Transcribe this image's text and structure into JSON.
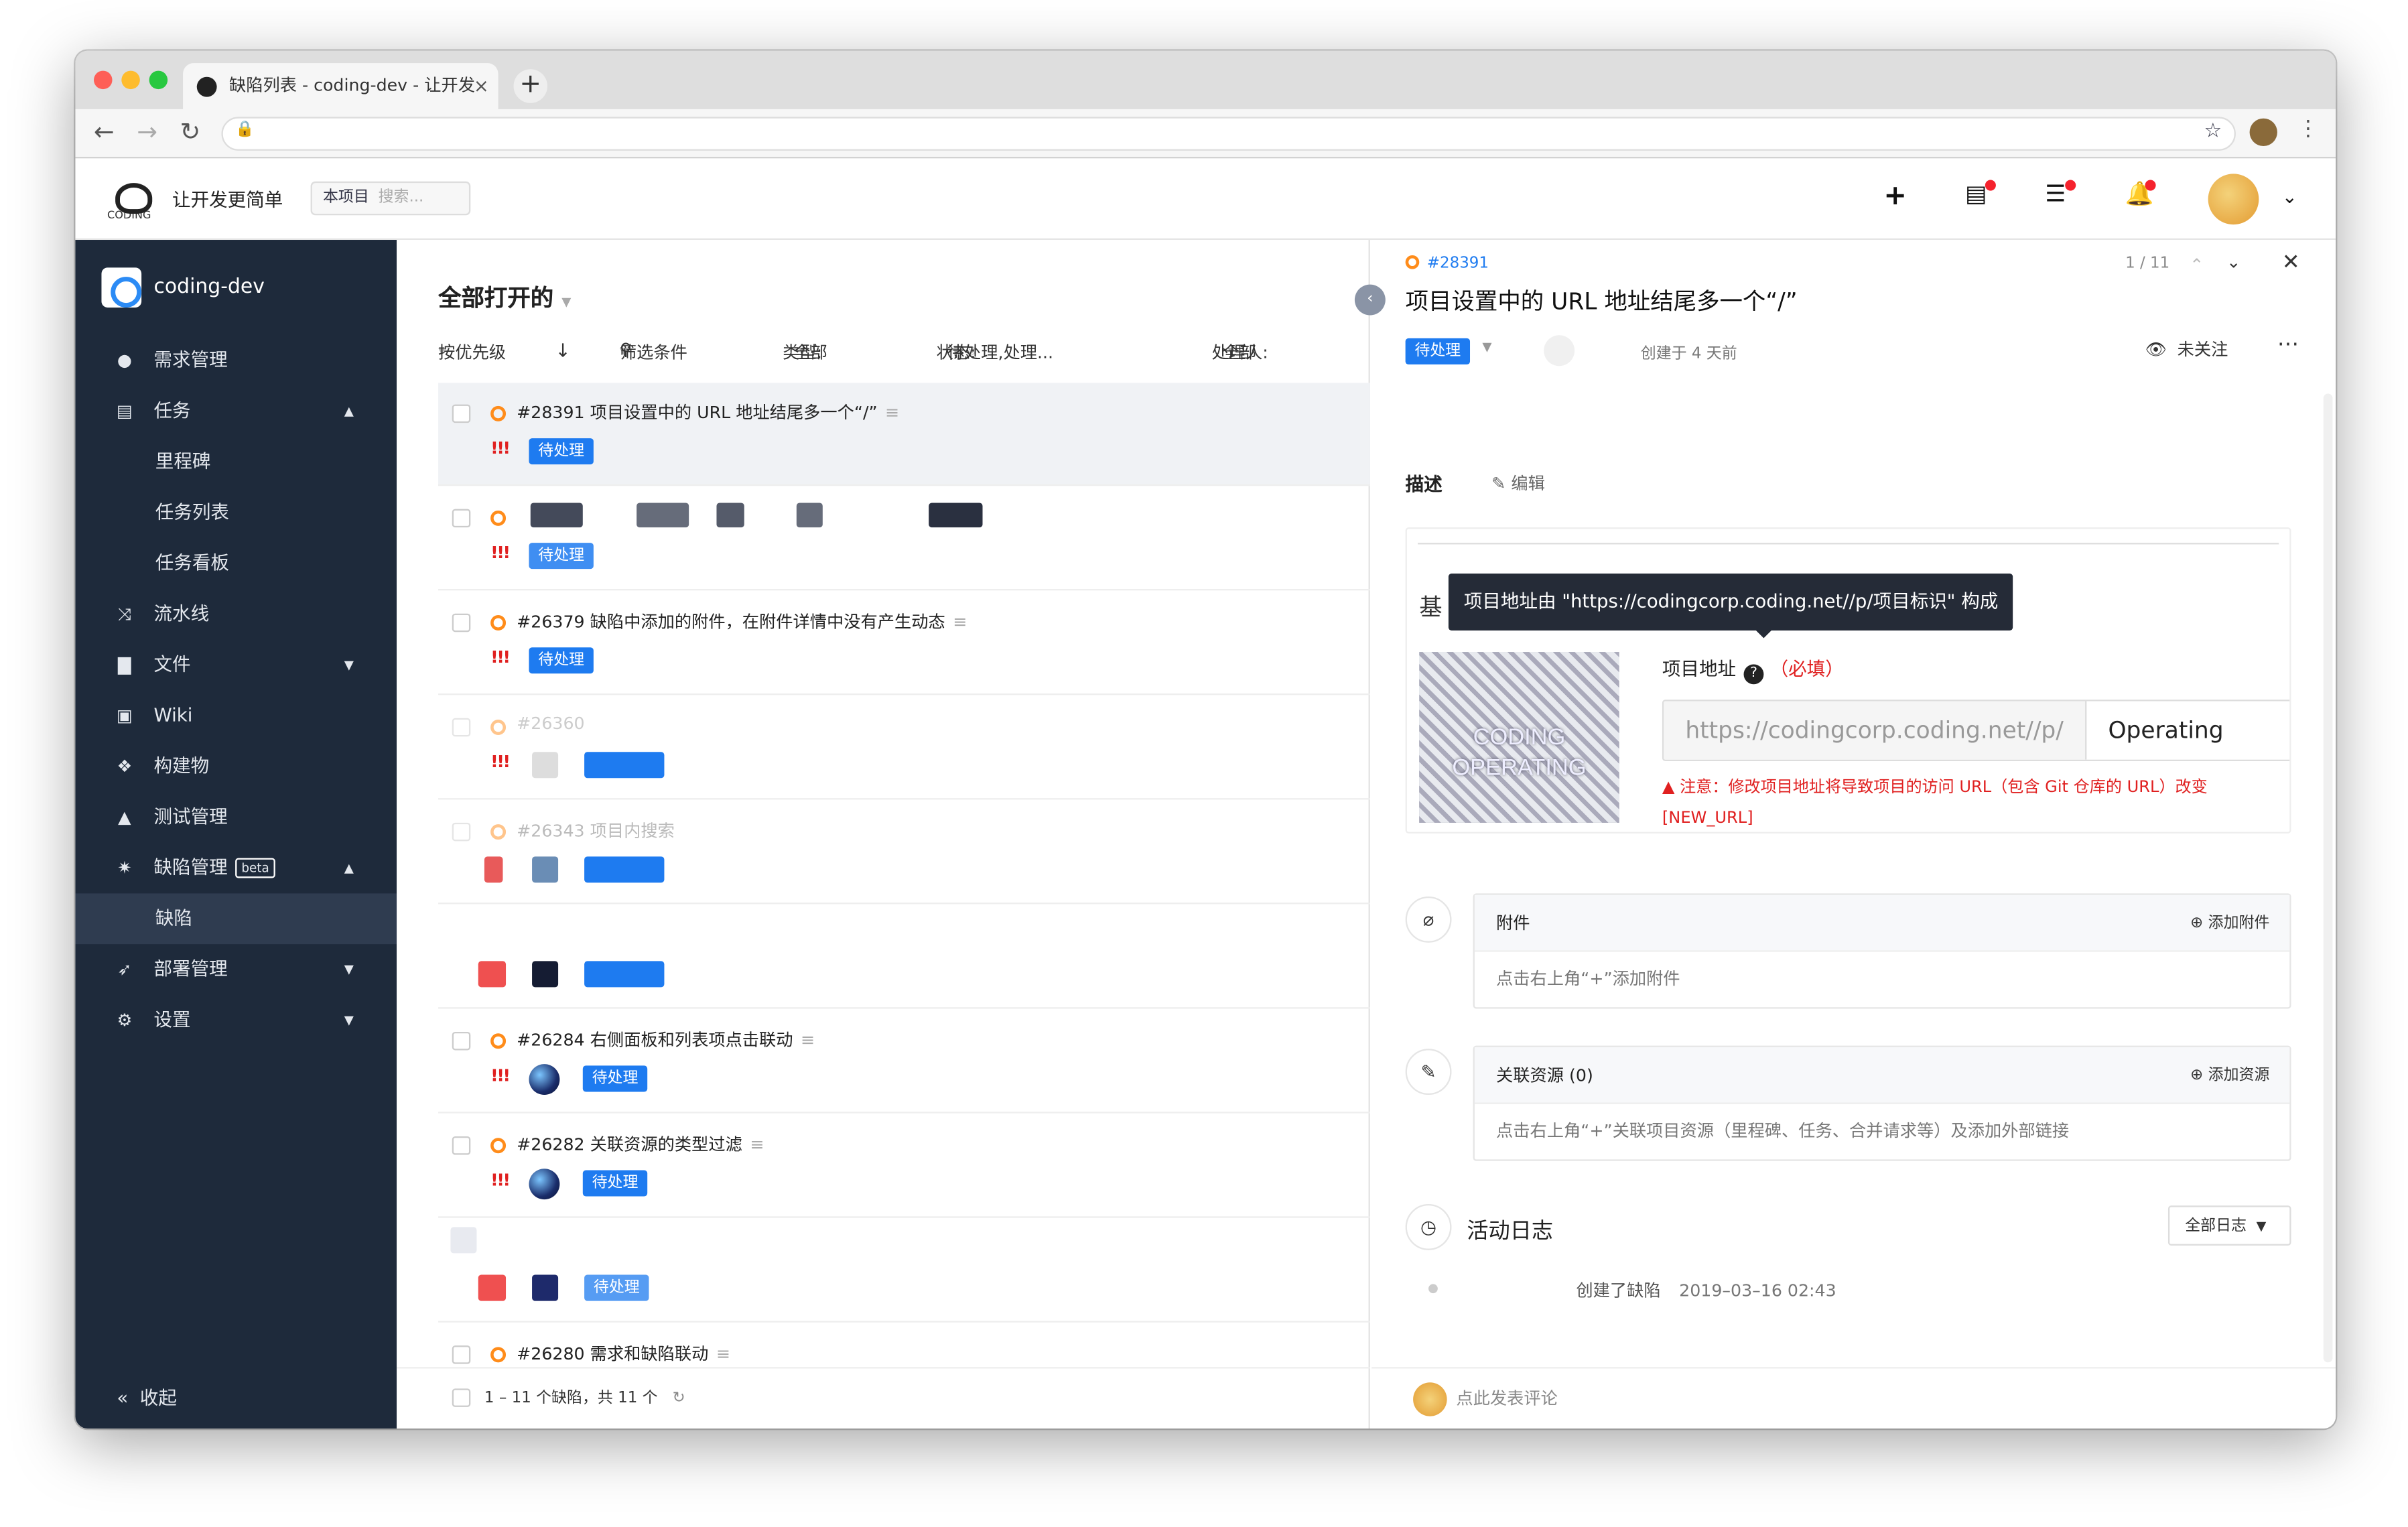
{
  "browser": {
    "tab_title": "缺陷列表 - coding-dev - 让开发",
    "tab_close": "×",
    "new_tab": "+"
  },
  "header": {
    "logo_text": "CODING",
    "brand": "让开发更简单",
    "scope_label": "本项目",
    "search_placeholder": "搜索..."
  },
  "sidebar": {
    "project": "coding-dev",
    "items": [
      {
        "label": "需求管理",
        "icon": "lightbulb-icon"
      },
      {
        "label": "任务",
        "icon": "list-icon"
      },
      {
        "label": "里程碑"
      },
      {
        "label": "任务列表"
      },
      {
        "label": "任务看板"
      },
      {
        "label": "流水线",
        "icon": "shuffle-icon"
      },
      {
        "label": "文件",
        "icon": "file-icon"
      },
      {
        "label": "Wiki",
        "icon": "wiki-icon"
      },
      {
        "label": "构建物",
        "icon": "cubes-icon"
      },
      {
        "label": "测试管理",
        "icon": "flask-icon"
      },
      {
        "label": "缺陷管理",
        "icon": "bug-icon",
        "badge": "beta"
      },
      {
        "label": "缺陷"
      },
      {
        "label": "部署管理",
        "icon": "rocket-icon"
      },
      {
        "label": "设置",
        "icon": "gears-icon"
      }
    ],
    "collapse": "收起"
  },
  "list": {
    "title": "全部打开的",
    "filters": {
      "sort": "按优先级",
      "filter": "筛选条件",
      "type_label": "类型:",
      "type_value": "全部",
      "status_label": "状态:",
      "status_value": "待处理,处理...",
      "assignee_label": "处理人:",
      "assignee_value": "全部"
    },
    "rows": [
      {
        "title": "#28391 项目设置中的 URL 地址结尾多一个“/”",
        "priority": "!!!",
        "status": "待处理"
      },
      {
        "title": "",
        "priority": "!!!",
        "status": "待处理"
      },
      {
        "title": "#26379 缺陷中添加的附件，在附件详情中没有产生动态",
        "priority": "!!!",
        "status": "待处理"
      },
      {
        "title": "#26360",
        "priority": "!!!",
        "status": ""
      },
      {
        "title": "#26343 项目内搜索",
        "priority": "",
        "status": ""
      },
      {
        "title": "",
        "priority": "",
        "status": ""
      },
      {
        "title": "#26284 右侧面板和列表项点击联动",
        "priority": "!!!",
        "status": "待处理"
      },
      {
        "title": "#26282 关联资源的类型过滤",
        "priority": "!!!",
        "status": "待处理"
      },
      {
        "title": "",
        "priority": "",
        "status": "待处理"
      },
      {
        "title": "#26280 需求和缺陷联动",
        "priority": "",
        "status": ""
      }
    ],
    "footer": "1 – 11 个缺陷，共 11 个"
  },
  "detail": {
    "id": "#28391",
    "pager": "1 / 11",
    "title": "项目设置中的 URL 地址结尾多一个“/”",
    "status": "待处理",
    "created": "创建于 4 天前",
    "watch": "未关注",
    "desc_label": "描述",
    "edit_label": "编辑",
    "tooltip": "项目地址由 \"https://codingcorp.coding.net//p/项目标识\" 构成",
    "base_char": "基",
    "image_caption_1": "CODING",
    "image_caption_2": "OPERATING",
    "field_label": "项目地址",
    "field_required": "（必填）",
    "url_prefix": "https://codingcorp.coding.net//p/",
    "url_value": "Operating",
    "warning": "▲ 注意：修改项目地址将导致项目的访问 URL（包含 Git 仓库的 URL）改变",
    "warning_2": "[NEW_URL]",
    "attachments_title": "附件",
    "attachments_action": "添加附件",
    "attachments_empty": "点击右上角“+”添加附件",
    "resources_title": "关联资源 (0)",
    "resources_action": "添加资源",
    "resources_empty": "点击右上角“+”关联项目资源（里程碑、任务、合并请求等）及添加外部链接",
    "activity_title": "活动日志",
    "activity_filter": "全部日志",
    "activity_action": "创建了缺陷",
    "activity_time": "2019–03–16 02:43",
    "comment_placeholder": "点此发表评论"
  },
  "colors": {
    "sidebar_bg": "#1e2a3b",
    "accent": "#1e7bf0",
    "priority": "#e02020",
    "status_open": "#ff8c1a"
  }
}
